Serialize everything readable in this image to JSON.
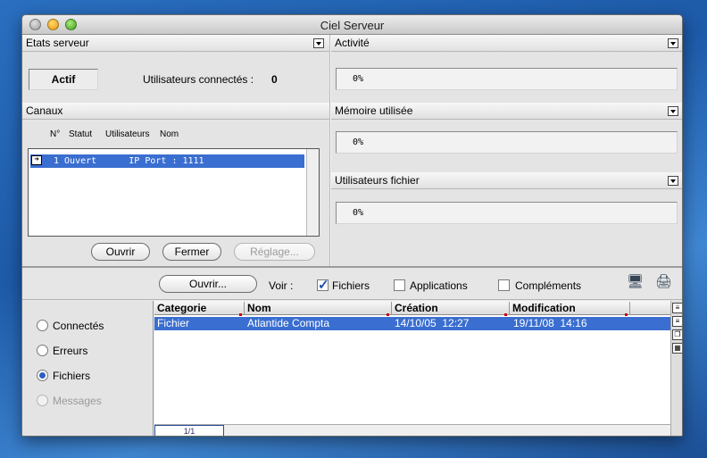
{
  "window": {
    "title": "Ciel Serveur"
  },
  "server_state": {
    "header": "Etats serveur",
    "status": "Actif",
    "users_label": "Utilisateurs connectés :",
    "users_count": "0"
  },
  "activity": {
    "header": "Activité",
    "value": "0%"
  },
  "memory": {
    "header": "Mémoire utilisée",
    "value": "0%"
  },
  "file_users": {
    "header": "Utilisateurs fichier",
    "value": "0%"
  },
  "channels": {
    "header": "Canaux",
    "columns": [
      "N°",
      "Statut",
      "Utilisateurs",
      "Nom"
    ],
    "rows": [
      {
        "text": "1 Ouvert      IP Port : 1111"
      }
    ],
    "buttons": {
      "open": "Ouvrir",
      "close": "Fermer",
      "settings": "Réglage..."
    }
  },
  "toolbar": {
    "open_button": "Ouvrir...",
    "view_label": "Voir :",
    "checkboxes": [
      {
        "label": "Fichiers",
        "checked": true
      },
      {
        "label": "Applications",
        "checked": false
      },
      {
        "label": "Compléments",
        "checked": false
      }
    ]
  },
  "views": [
    {
      "label": "Connectés",
      "selected": false,
      "enabled": true
    },
    {
      "label": "Erreurs",
      "selected": false,
      "enabled": true
    },
    {
      "label": "Fichiers",
      "selected": true,
      "enabled": true
    },
    {
      "label": "Messages",
      "selected": false,
      "enabled": false
    }
  ],
  "table": {
    "columns": [
      "Categorie",
      "Nom",
      "Création",
      "Modification"
    ],
    "rows": [
      {
        "categorie": "Fichier",
        "nom": "Atlantide Compta",
        "creation": "14/10/05  12:27",
        "modification": "19/11/08  14:16"
      }
    ],
    "page": "1/1"
  },
  "colors": {
    "selection": "#3a6ed0"
  }
}
